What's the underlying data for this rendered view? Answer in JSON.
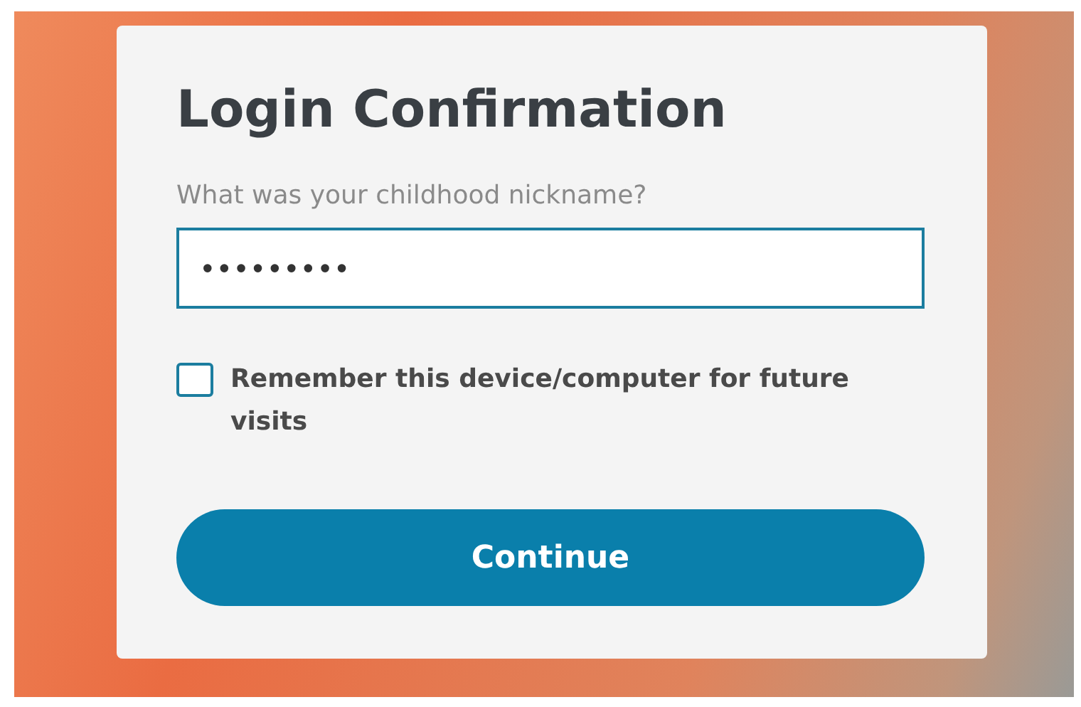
{
  "card": {
    "title": "Login Confirmation",
    "question": "What was your childhood nickname?",
    "answer": {
      "value": "•••••••••",
      "focused": true
    },
    "remember": {
      "label": "Remember this device/computer for future visits",
      "checked": false
    },
    "buttons": [
      "Continue"
    ]
  }
}
